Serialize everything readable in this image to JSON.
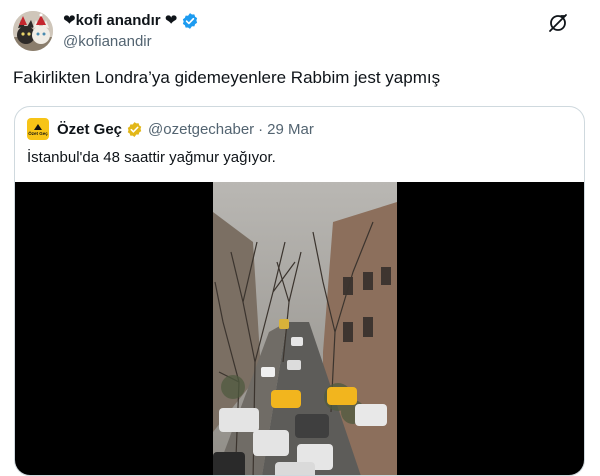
{
  "tweet": {
    "author_name": "❤kofi anandır ❤",
    "author_handle": "@kofianandir",
    "text": "Fakirlikten Londra’ya gidemeyenlere Rabbim jest yapmış",
    "icons": {
      "verified": "verified-badge-icon",
      "grok": "grok-icon"
    },
    "colors": {
      "verified": "#1d9bf0",
      "secondary_text": "#536471",
      "border": "#cfd9de"
    }
  },
  "quote": {
    "author_name": "Özet Geç",
    "author_handle": "@ozetgechaber",
    "separator": "·",
    "date": "29 Mar",
    "text": "İstanbul'da 48 saattir yağmur yağıyor.",
    "avatar": {
      "logo_line1": "Özet",
      "logo_line2": "Geç",
      "color": "#f7c417"
    },
    "badge_color": "#e2b719",
    "media": {
      "type": "video",
      "description_icon": "video-thumbnail"
    }
  }
}
